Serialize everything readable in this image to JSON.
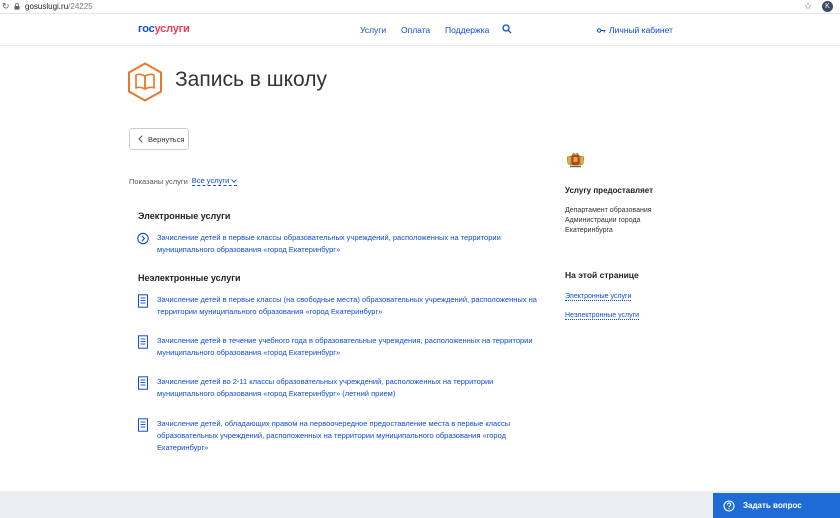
{
  "browser": {
    "url_host": "gosuslugi.ru",
    "url_path": "/24225",
    "profile_initial": "K"
  },
  "header": {
    "logo_part1": "гос",
    "logo_part2": "услуги",
    "nav": [
      {
        "label": "Услуги"
      },
      {
        "label": "Оплата"
      },
      {
        "label": "Поддержка"
      }
    ],
    "cabinet_label": "Личный кабинет"
  },
  "page": {
    "title": "Запись в школу",
    "back_label": "Вернуться",
    "filter_label": "Показаны услуги",
    "filter_value": "Все услуги"
  },
  "electronic": {
    "heading": "Электронные услуги",
    "items": [
      {
        "text": "Зачисление детей в первые классы образовательных учреждений, расположенных на территории муниципального образования «город Екатеринбург»"
      }
    ]
  },
  "nonelectronic": {
    "heading": "Неэлектронные услуги",
    "items": [
      {
        "text": "Зачисление детей в первые классы (на свободные места) образовательных учреждений, расположенных на территории муниципального образования «город Екатеринбург»"
      },
      {
        "text": "Зачисление детей в течение учебного года в образовательные учреждения, расположенных на территории муниципального образования «город Екатеринбург»"
      },
      {
        "text": "Зачисление детей во 2-11 классы образовательных учреждений, расположенных на территории муниципального образования «город Екатеринбург» (летний прием)"
      },
      {
        "text": "Зачисление детей, обладающих правом на первоочередное предоставление места в первые классы образовательных учреждений, расположенных на территории муниципального образования «город Екатеринбург»"
      }
    ]
  },
  "sidebar": {
    "provider_heading": "Услугу предоставляет",
    "provider_name": "Департамент образования Администрации города Екатеринбурга",
    "onpage_heading": "На этой странице",
    "anchors": [
      {
        "label": "Электронные услуги"
      },
      {
        "label": "Неэлектронные услуги"
      }
    ]
  },
  "widget": {
    "ask_label": "Задать вопрос"
  },
  "icons": {
    "reload": "reload-icon",
    "lock": "lock-icon",
    "star": "bookmark-star-icon",
    "search": "search-icon",
    "key": "key-icon",
    "book": "book-icon",
    "chevron_left": "chevron-left-icon",
    "chevron_down": "chevron-down-icon",
    "arrow_circle": "arrow-right-circle-icon",
    "document": "document-icon",
    "coat_of_arms": "coat-of-arms-icon",
    "support": "support-chat-icon"
  },
  "colors": {
    "brand_blue": "#0d4cd3",
    "brand_red": "#ee3f58",
    "title_icon_orange": "#e8792b",
    "widget_blue": "#1e6bd6"
  }
}
